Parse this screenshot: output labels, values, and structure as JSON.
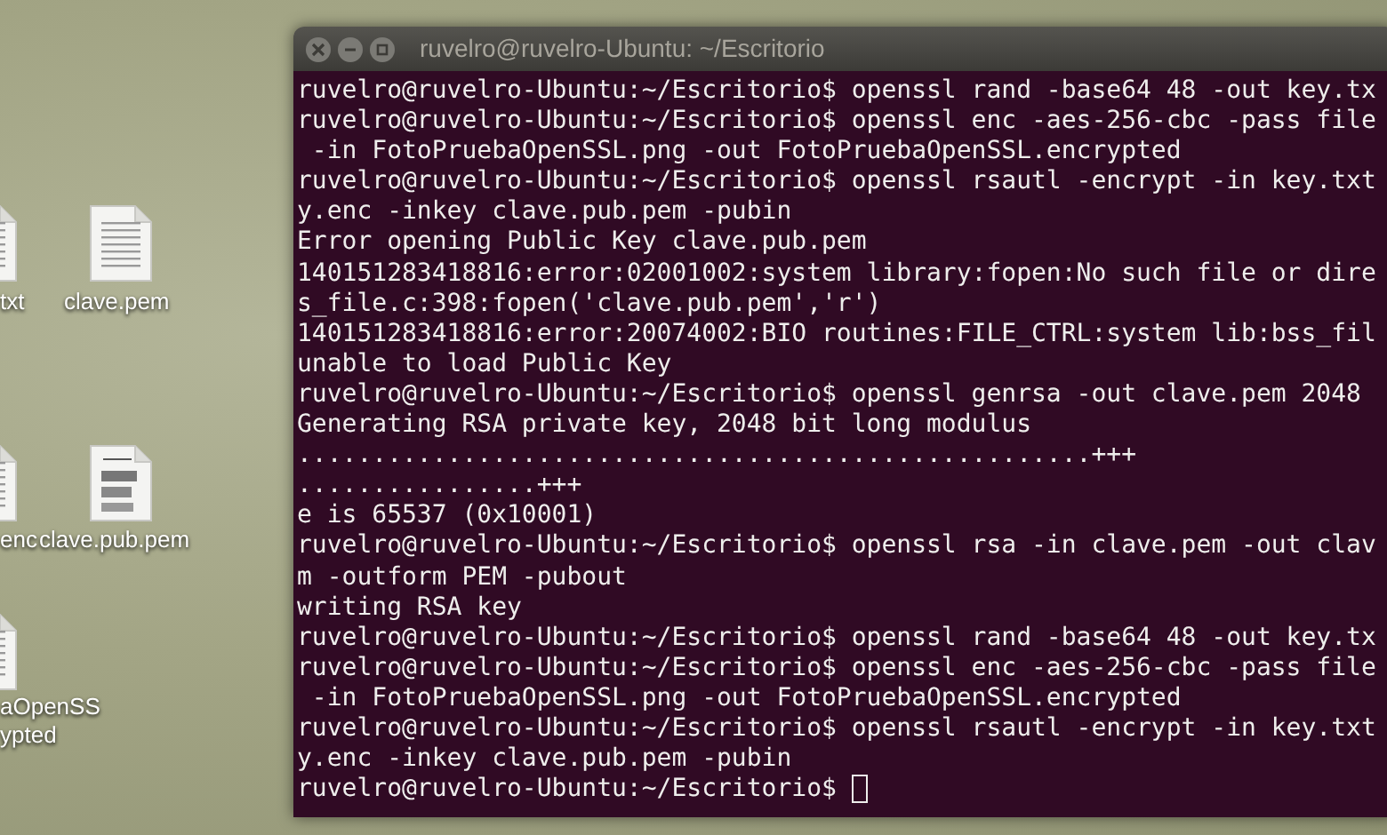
{
  "desktop": {
    "icons": [
      {
        "label": "txt",
        "kind": "text"
      },
      {
        "label": "clave.pem",
        "kind": "text"
      },
      {
        "label": "enc",
        "kind": "text"
      },
      {
        "label": "clave.pub.pem",
        "kind": "key"
      },
      {
        "label": "aOpenSS\nypted",
        "kind": "text"
      }
    ]
  },
  "window": {
    "title": "ruvelro@ruvelro-Ubuntu: ~/Escritorio",
    "cursor_visible": true,
    "lines": [
      "ruvelro@ruvelro-Ubuntu:~/Escritorio$ openssl rand -base64 48 -out key.tx",
      "ruvelro@ruvelro-Ubuntu:~/Escritorio$ openssl enc -aes-256-cbc -pass file",
      " -in FotoPruebaOpenSSL.png -out FotoPruebaOpenSSL.encrypted",
      "ruvelro@ruvelro-Ubuntu:~/Escritorio$ openssl rsautl -encrypt -in key.txt",
      "y.enc -inkey clave.pub.pem -pubin",
      "Error opening Public Key clave.pub.pem",
      "140151283418816:error:02001002:system library:fopen:No such file or dire",
      "s_file.c:398:fopen('clave.pub.pem','r')",
      "140151283418816:error:20074002:BIO routines:FILE_CTRL:system lib:bss_fil",
      "unable to load Public Key",
      "ruvelro@ruvelro-Ubuntu:~/Escritorio$ openssl genrsa -out clave.pem 2048",
      "Generating RSA private key, 2048 bit long modulus",
      ".....................................................+++",
      "................+++",
      "e is 65537 (0x10001)",
      "ruvelro@ruvelro-Ubuntu:~/Escritorio$ openssl rsa -in clave.pem -out clav",
      "m -outform PEM -pubout",
      "writing RSA key",
      "ruvelro@ruvelro-Ubuntu:~/Escritorio$ openssl rand -base64 48 -out key.tx",
      "ruvelro@ruvelro-Ubuntu:~/Escritorio$ openssl enc -aes-256-cbc -pass file",
      " -in FotoPruebaOpenSSL.png -out FotoPruebaOpenSSL.encrypted",
      "ruvelro@ruvelro-Ubuntu:~/Escritorio$ openssl rsautl -encrypt -in key.txt",
      "y.enc -inkey clave.pub.pem -pubin",
      "ruvelro@ruvelro-Ubuntu:~/Escritorio$ "
    ]
  }
}
